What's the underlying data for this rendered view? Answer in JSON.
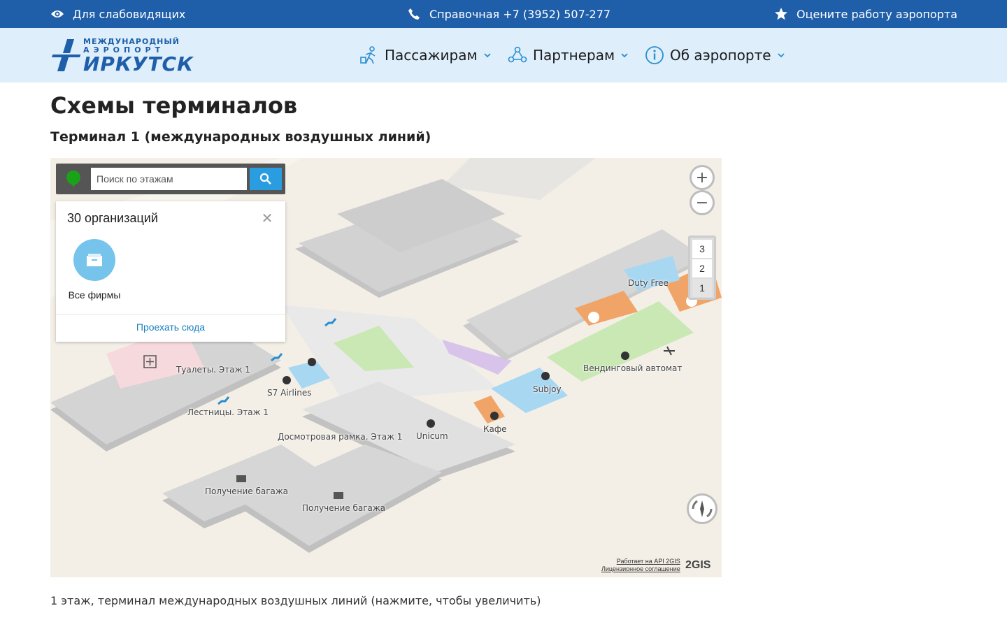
{
  "topbar": {
    "accessibility": "Для слабовидящих",
    "phone": "Справочная +7 (3952) 507-277",
    "rate": "Оцените работу аэропорта"
  },
  "logo": {
    "line1": "МЕЖДУНАРОДНЫЙ",
    "line2": "АЭРОПОРТ",
    "line3": "ИРКУТСК"
  },
  "nav": {
    "passengers": "Пассажирам",
    "partners": "Партнерам",
    "about": "Об аэропорте"
  },
  "page": {
    "title": "Схемы терминалов",
    "subtitle": "Терминал 1 (международных воздушных линий)",
    "caption": "1 этаж, терминал международных воздушных линий (нажмите, чтобы увеличить)"
  },
  "map": {
    "search_placeholder": "Поиск по этажам",
    "org_count": "30 организаций",
    "category_all": "Все фирмы",
    "route_link": "Проехать сюда",
    "floors": [
      "3",
      "2",
      "1"
    ],
    "active_floor": "1",
    "attribution_api": "Работает на API 2GIS",
    "attribution_license": "Лицензионное соглашение",
    "provider_logo": "2GIS",
    "labels": {
      "duty_free": "Duty Free",
      "toilets": "Туалеты. Этаж 1",
      "s7": "S7 Airlines",
      "stairs": "Лестницы. Этаж 1",
      "vending": "Вендинговый автомат",
      "subjoy": "Subjoy",
      "cafe": "Кафе",
      "unicum": "Unicum",
      "security": "Досмотровая рамка. Этаж 1",
      "baggage_1": "Получение багажа",
      "baggage_2": "Получение багажа"
    }
  }
}
